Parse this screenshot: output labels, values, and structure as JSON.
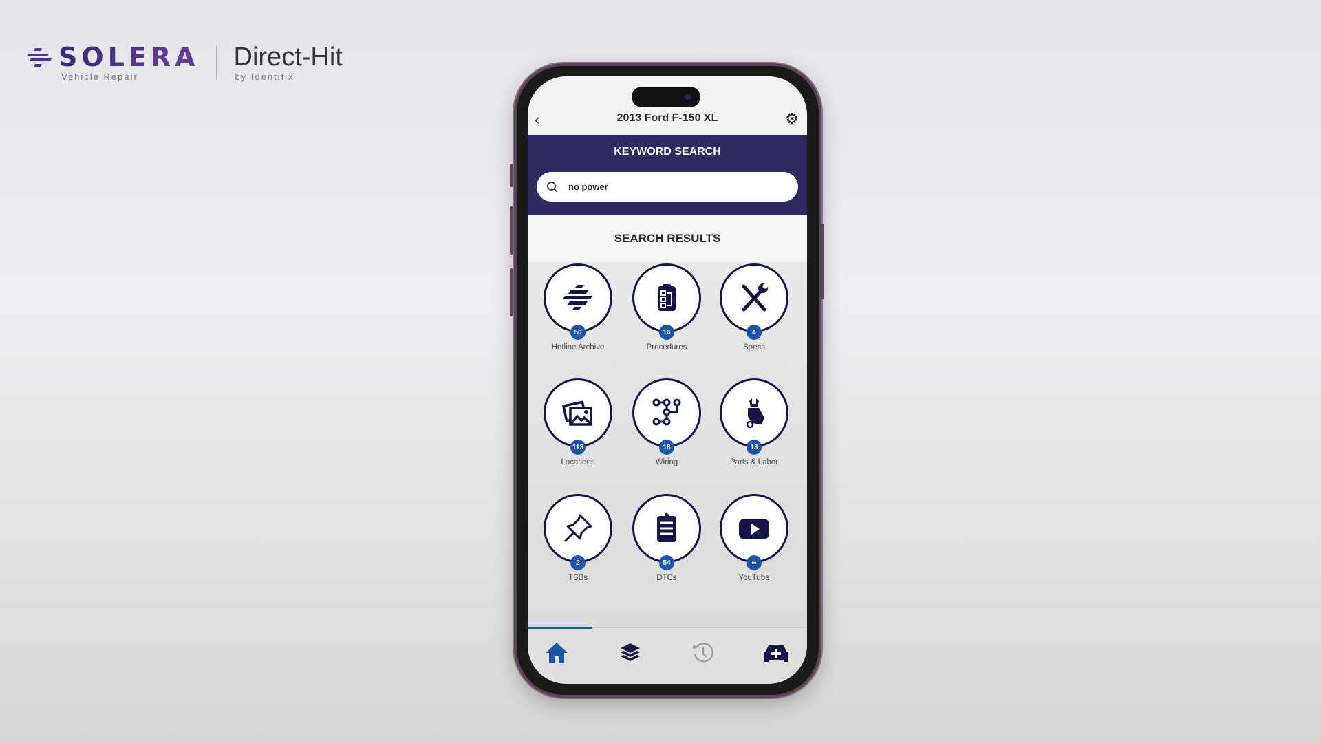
{
  "logo": {
    "brand": "SOLERA",
    "brand_sub": "Vehicle Repair",
    "product": "Direct-Hit",
    "product_sub": "by Identifix"
  },
  "header": {
    "title": "2013 Ford F-150 XL",
    "back_icon": "chevron-left-icon",
    "settings_icon": "gear-icon"
  },
  "search": {
    "heading": "KEYWORD SEARCH",
    "value": "no power",
    "icon": "search-icon"
  },
  "results": {
    "heading": "SEARCH RESULTS",
    "items": [
      {
        "label": "Hotline Archive",
        "count": "50",
        "icon": "hotline-archive-icon"
      },
      {
        "label": "Procedures",
        "count": "16",
        "icon": "clipboard-flow-icon"
      },
      {
        "label": "Specs",
        "count": "4",
        "icon": "tools-icon"
      },
      {
        "label": "Locations",
        "count": "113",
        "icon": "images-icon"
      },
      {
        "label": "Wiring",
        "count": "18",
        "icon": "circuit-icon"
      },
      {
        "label": "Parts & Labor",
        "count": "13",
        "icon": "hand-wrench-icon"
      },
      {
        "label": "TSBs",
        "count": "2",
        "icon": "pushpin-icon"
      },
      {
        "label": "DTCs",
        "count": "54",
        "icon": "clipboard-list-icon"
      },
      {
        "label": "YouTube",
        "count": "∞",
        "icon": "youtube-icon"
      }
    ]
  },
  "tabbar": {
    "tabs": [
      {
        "name": "home",
        "icon": "home-icon",
        "active": true
      },
      {
        "name": "layers",
        "icon": "layers-icon"
      },
      {
        "name": "history",
        "icon": "history-icon"
      },
      {
        "name": "add-vehicle",
        "icon": "car-plus-icon"
      }
    ]
  },
  "colors": {
    "band": "#2f2a60",
    "accent": "#1d56a6",
    "icon": "#141648"
  }
}
